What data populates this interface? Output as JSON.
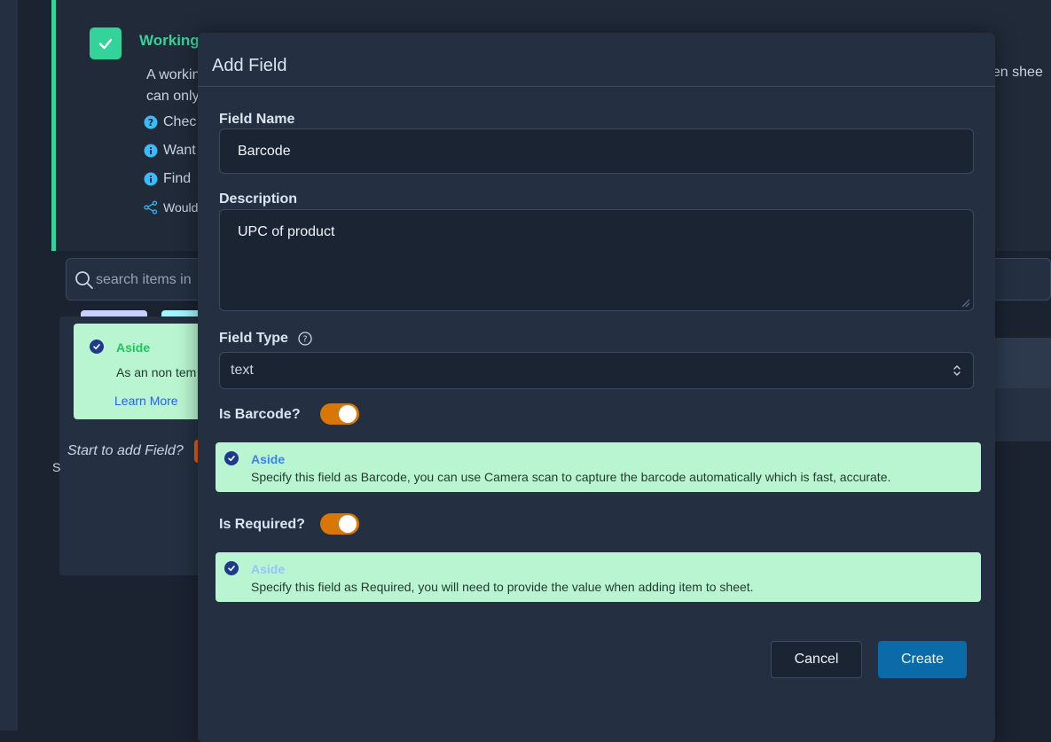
{
  "background": {
    "working": {
      "title": "Working",
      "body_line1": "A workin",
      "body_line2": "can only",
      "right_text": "een shee",
      "hints": [
        {
          "icon": "question-circle-icon",
          "text": "Chec"
        },
        {
          "icon": "info-circle-icon",
          "text": "Want"
        },
        {
          "icon": "info-circle-icon",
          "text": "Find"
        },
        {
          "icon": "share-icon",
          "text": "Would"
        }
      ]
    },
    "search": {
      "placeholder": "search items in"
    },
    "aside": {
      "title": "Aside",
      "text": "As an non tem",
      "learn_more": "Learn More"
    },
    "start_text": "Start to add Field?",
    "s_text": "S"
  },
  "modal": {
    "title": "Add Field",
    "field_name": {
      "label": "Field Name",
      "value": "Barcode"
    },
    "description": {
      "label": "Description",
      "value": "UPC of product"
    },
    "field_type": {
      "label": "Field Type",
      "value": "text"
    },
    "is_barcode": {
      "label": "Is Barcode?",
      "on": true,
      "aside_title": "Aside",
      "aside_text": "Specify this field as Barcode, you can use Camera scan to capture the barcode automatically which is fast, accurate."
    },
    "is_required": {
      "label": "Is Required?",
      "on": true,
      "aside_title": "Aside",
      "aside_text": "Specify this field as Required, you will need to provide the value when adding item to sheet."
    },
    "buttons": {
      "cancel": "Cancel",
      "create": "Create"
    }
  },
  "colors": {
    "accent_green": "#34d399",
    "toggle_on": "#d97706",
    "primary": "#0b6aa8",
    "aside_bg": "#b9f5d0"
  }
}
